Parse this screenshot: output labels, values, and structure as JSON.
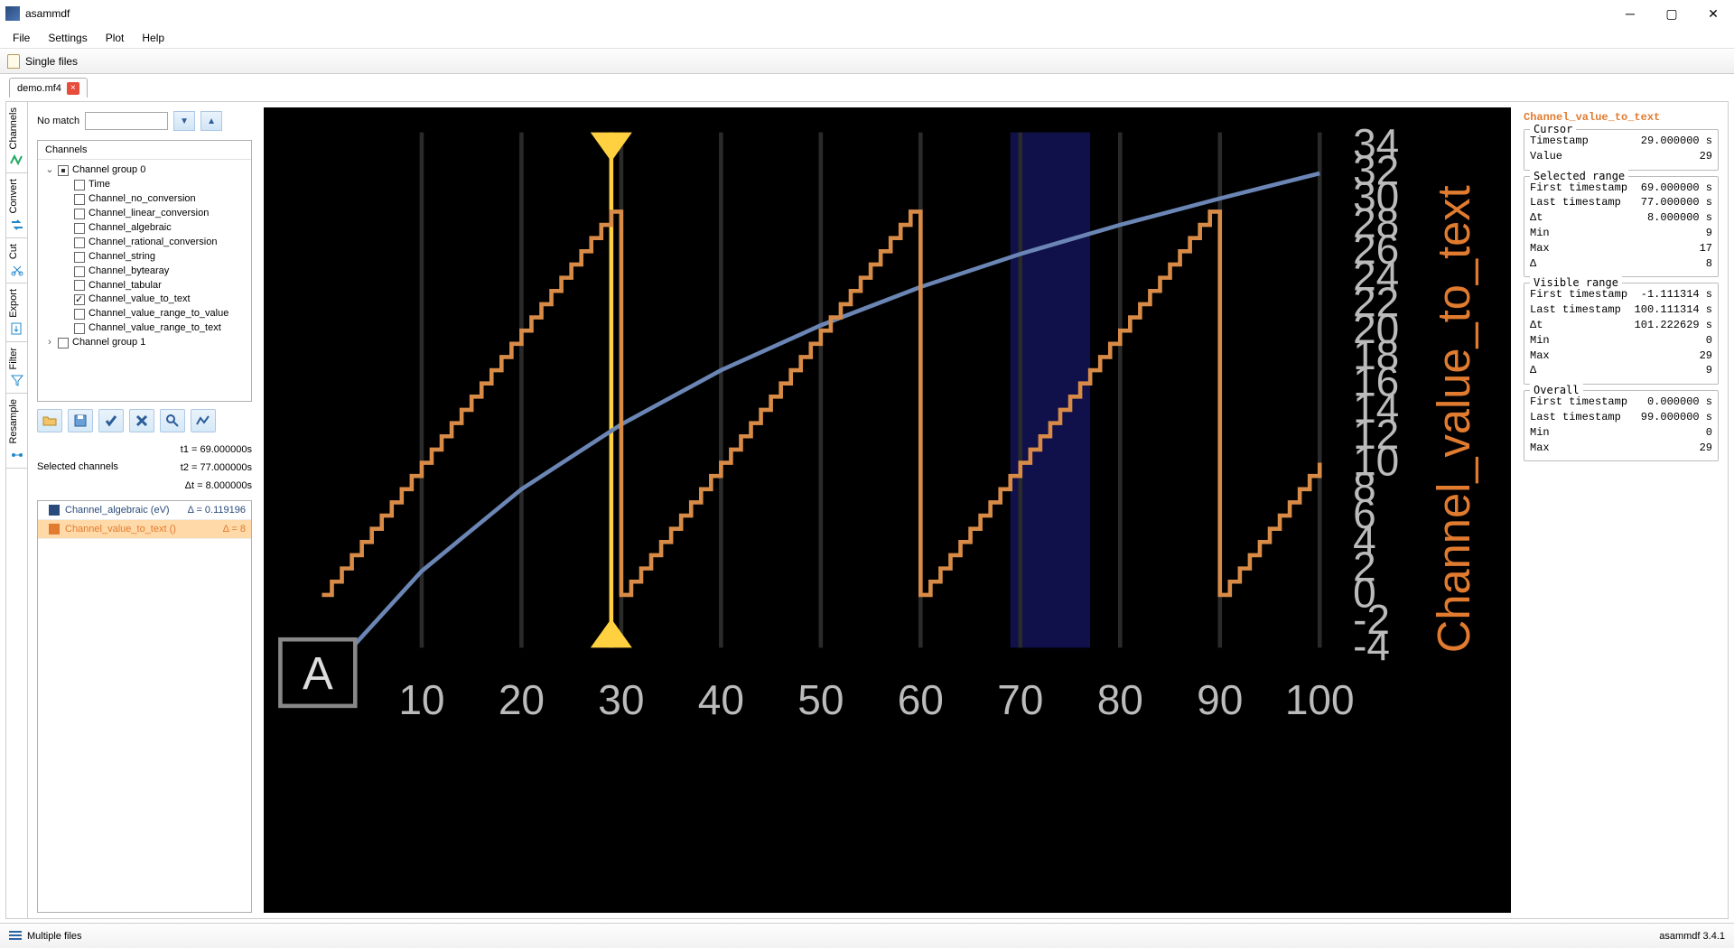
{
  "window": {
    "title": "asammdf"
  },
  "menu": [
    "File",
    "Settings",
    "Plot",
    "Help"
  ],
  "mode_toolbar": {
    "label": "Single files"
  },
  "open_tab": {
    "name": "demo.mf4"
  },
  "vtabs": [
    "Channels",
    "Convert",
    "Cut",
    "Export",
    "Filter",
    "Resample"
  ],
  "search": {
    "no_match": "No match"
  },
  "tree": {
    "header": "Channels",
    "group0": {
      "label": "Channel group 0",
      "children": [
        {
          "label": "Time",
          "checked": false
        },
        {
          "label": "Channel_no_conversion",
          "checked": false
        },
        {
          "label": "Channel_linear_conversion",
          "checked": false
        },
        {
          "label": "Channel_algebraic",
          "checked": false
        },
        {
          "label": "Channel_rational_conversion",
          "checked": false
        },
        {
          "label": "Channel_string",
          "checked": false
        },
        {
          "label": "Channel_bytearay",
          "checked": false
        },
        {
          "label": "Channel_tabular",
          "checked": false
        },
        {
          "label": "Channel_value_to_text",
          "checked": true
        },
        {
          "label": "Channel_value_range_to_value",
          "checked": false
        },
        {
          "label": "Channel_value_range_to_text",
          "checked": false
        }
      ]
    },
    "group1": {
      "label": "Channel group 1"
    }
  },
  "time_marks": {
    "t1": "t1 = 69.000000s",
    "t2": "t2 = 77.000000s",
    "dt": "Δt = 8.000000s"
  },
  "selected_channels_label": "Selected channels",
  "selected_channels": [
    {
      "name": "Channel_algebraic (eV)",
      "color": "#294a7a",
      "delta": "Δ = 0.119196"
    },
    {
      "name": "Channel_value_to_text ()",
      "color": "#e07b2f",
      "delta": "Δ = 8"
    }
  ],
  "chart_data": {
    "type": "line",
    "x_range": [
      0,
      100
    ],
    "y_range": [
      -4,
      35
    ],
    "x_ticks": [
      10,
      20,
      30,
      40,
      50,
      60,
      70,
      80,
      90,
      100
    ],
    "y_ticks": [
      -4,
      -2,
      0,
      2,
      4,
      6,
      8,
      10,
      12,
      14,
      16,
      18,
      20,
      22,
      24,
      26,
      28,
      30,
      32,
      34
    ],
    "y_axis_label": "Channel_value_to_text",
    "cursor_x": 29,
    "selection_x": [
      69,
      77
    ],
    "series": [
      {
        "name": "Channel_algebraic",
        "color": "#6b86b5",
        "style": "smooth",
        "x": [
          3,
          10,
          20,
          30,
          40,
          50,
          60,
          70,
          80,
          90,
          100
        ],
        "y": [
          -4,
          1.8,
          8.0,
          12.9,
          17.0,
          20.4,
          23.3,
          25.8,
          28.0,
          30.0,
          31.9
        ]
      },
      {
        "name": "Channel_value_to_text",
        "color": "#d88b47",
        "style": "step",
        "period": 30,
        "levels_per_period": 30,
        "x_start": 0,
        "y_min": 0,
        "y_max": 29
      }
    ]
  },
  "stats": {
    "title": "Channel_value_to_text",
    "cursor": {
      "legend": "Cursor",
      "rows": [
        [
          "Timestamp",
          "29.000000 s"
        ],
        [
          "Value",
          "29"
        ]
      ]
    },
    "selected": {
      "legend": "Selected range",
      "rows": [
        [
          "First timestamp",
          "69.000000 s"
        ],
        [
          "Last timestamp",
          "77.000000 s"
        ],
        [
          "Δt",
          "8.000000 s"
        ],
        [
          "Min",
          "9"
        ],
        [
          "Max",
          "17"
        ],
        [
          "Δ",
          "8"
        ]
      ]
    },
    "visible": {
      "legend": "Visible range",
      "rows": [
        [
          "First timestamp",
          "-1.111314 s"
        ],
        [
          "Last timestamp",
          "100.111314 s"
        ],
        [
          "Δt",
          "101.222629 s"
        ],
        [
          "Min",
          "0"
        ],
        [
          "Max",
          "29"
        ],
        [
          "Δ",
          "9"
        ]
      ]
    },
    "overall": {
      "legend": "Overall",
      "rows": [
        [
          "First timestamp",
          "0.000000 s"
        ],
        [
          "Last timestamp",
          "99.000000 s"
        ],
        [
          "Min",
          "0"
        ],
        [
          "Max",
          "29"
        ]
      ]
    }
  },
  "statusbar": {
    "mode": "Multiple files",
    "version": "asammdf 3.4.1"
  }
}
